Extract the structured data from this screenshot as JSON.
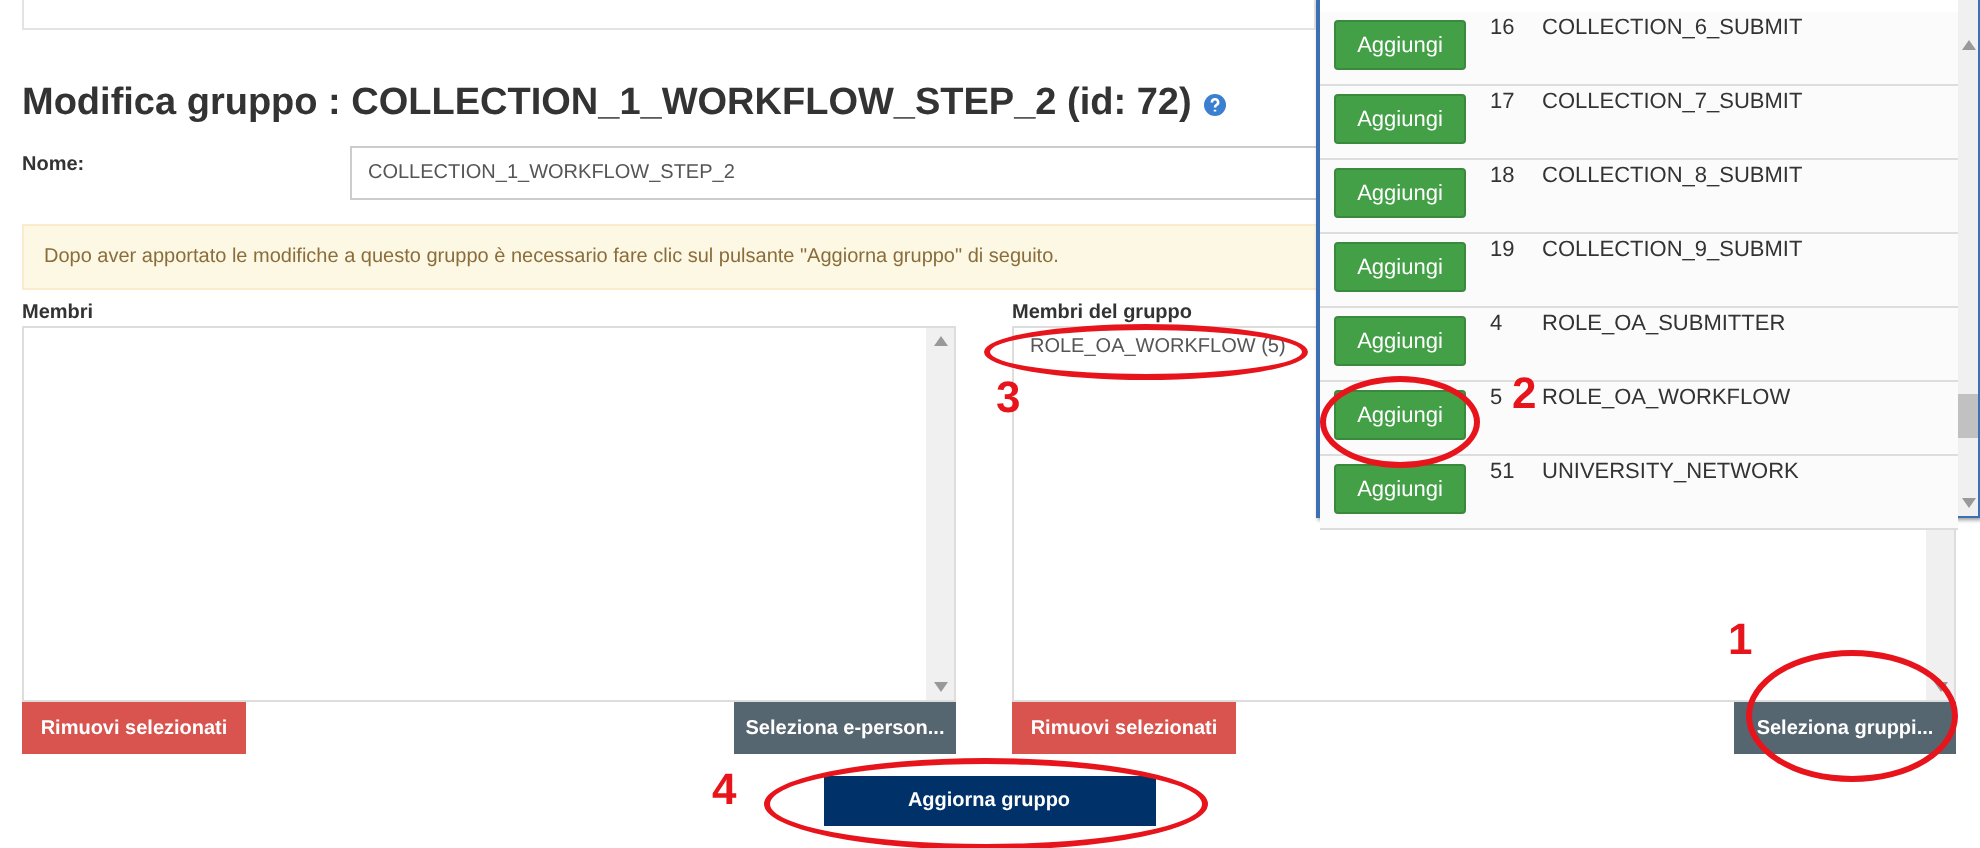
{
  "title": "Modifica gruppo : COLLECTION_1_WORKFLOW_STEP_2 (id: 72)",
  "name_field": {
    "label": "Nome:",
    "value": "COLLECTION_1_WORKFLOW_STEP_2"
  },
  "alert": "Dopo aver apportato le modifiche a questo gruppo è necessario fare clic sul pulsante \"Aggiorna gruppo\" di seguito.",
  "members": {
    "label": "Membri",
    "remove_button": "Rimuovi selezionati",
    "select_button": "Seleziona e-person..."
  },
  "group_members": {
    "label": "Membri del gruppo",
    "items": [
      "ROLE_OA_WORKFLOW (5)"
    ],
    "remove_button": "Rimuovi selezionati",
    "select_button": "Seleziona gruppi..."
  },
  "update_button": "Aggiorna gruppo",
  "popup": {
    "rows": [
      {
        "button": "Aggiungi",
        "id": "16",
        "name": "COLLECTION_6_SUBMIT"
      },
      {
        "button": "Aggiungi",
        "id": "17",
        "name": "COLLECTION_7_SUBMIT"
      },
      {
        "button": "Aggiungi",
        "id": "18",
        "name": "COLLECTION_8_SUBMIT"
      },
      {
        "button": "Aggiungi",
        "id": "19",
        "name": "COLLECTION_9_SUBMIT"
      },
      {
        "button": "Aggiungi",
        "id": "4",
        "name": "ROLE_OA_SUBMITTER"
      },
      {
        "button": "Aggiungi",
        "id": "5",
        "name": "ROLE_OA_WORKFLOW"
      },
      {
        "button": "Aggiungi",
        "id": "51",
        "name": "UNIVERSITY_NETWORK"
      }
    ]
  },
  "annotations": [
    {
      "label": "1"
    },
    {
      "label": "2"
    },
    {
      "label": "3"
    },
    {
      "label": "4"
    }
  ]
}
